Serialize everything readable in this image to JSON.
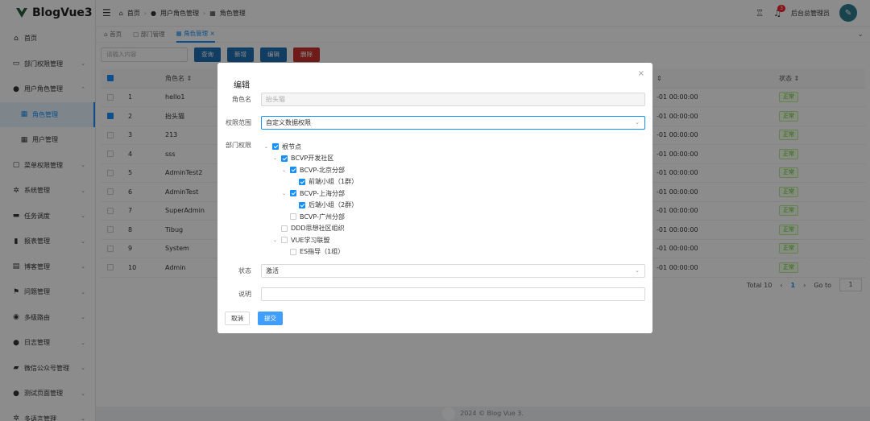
{
  "app": {
    "logo": "BlogVue3"
  },
  "sidebar": {
    "items": [
      {
        "label": "首页",
        "icon": "home-icon",
        "glyph": "⌂",
        "arrow": ""
      },
      {
        "label": "部门权限管理",
        "icon": "briefcase-icon",
        "glyph": "▭",
        "arrow": "⌄"
      },
      {
        "label": "用户角色管理",
        "icon": "user-icon",
        "glyph": "●",
        "arrow": "⌃"
      },
      {
        "label": "角色管理",
        "icon": "grid-icon",
        "glyph": "▦",
        "arrow": "",
        "sub": true,
        "active": true
      },
      {
        "label": "用户管理",
        "icon": "grid-icon",
        "glyph": "▦",
        "arrow": "",
        "sub": true
      },
      {
        "label": "菜单权限管理",
        "icon": "lock-icon",
        "glyph": "▢",
        "arrow": "⌄"
      },
      {
        "label": "系统管理",
        "icon": "gear-icon",
        "glyph": "✲",
        "arrow": "⌄"
      },
      {
        "label": "任务调度",
        "icon": "task-icon",
        "glyph": "▬",
        "arrow": "⌄"
      },
      {
        "label": "报表管理",
        "icon": "bar-chart-icon",
        "glyph": "▮",
        "arrow": "⌄"
      },
      {
        "label": "博客管理",
        "icon": "blog-icon",
        "glyph": "▤",
        "arrow": "⌄"
      },
      {
        "label": "问题管理",
        "icon": "flag-icon",
        "glyph": "⚑",
        "arrow": "⌄"
      },
      {
        "label": "多级路由",
        "icon": "route-icon",
        "glyph": "◉",
        "arrow": "⌄"
      },
      {
        "label": "日志管理",
        "icon": "log-icon",
        "glyph": "●",
        "arrow": "⌄"
      },
      {
        "label": "微信公众号管理",
        "icon": "wechat-icon",
        "glyph": "▰",
        "arrow": "⌄"
      },
      {
        "label": "测试页面管理",
        "icon": "test-icon",
        "glyph": "●",
        "arrow": "⌄"
      },
      {
        "label": "多语言管理",
        "icon": "language-icon",
        "glyph": "✲",
        "arrow": "⌄"
      }
    ]
  },
  "header": {
    "breadcrumb": [
      "首页",
      "用户角色管理",
      "角色管理"
    ],
    "user": "后台总管理员",
    "notification_count": "3"
  },
  "tabs": [
    {
      "label": "首页",
      "active": false
    },
    {
      "label": "部门管理",
      "active": false
    },
    {
      "label": "角色管理",
      "active": true
    }
  ],
  "toolbar": {
    "search_placeholder": "请输入内容",
    "query": "查询",
    "add": "新增",
    "edit": "编辑",
    "delete": "删除"
  },
  "table": {
    "headers": [
      "",
      "角色名 ⇕",
      "⇕",
      "状态 ⇕"
    ],
    "rows": [
      {
        "idx": "1",
        "name": "hello1",
        "date": "-01 00:00:00",
        "status": "正常",
        "checked": false
      },
      {
        "idx": "2",
        "name": "抬头猫",
        "date": "-01 00:00:00",
        "status": "正常",
        "checked": true
      },
      {
        "idx": "3",
        "name": "213",
        "date": "-01 00:00:00",
        "status": "正常",
        "checked": false
      },
      {
        "idx": "4",
        "name": "sss",
        "date": "-01 00:00:00",
        "status": "正常",
        "checked": false
      },
      {
        "idx": "5",
        "name": "AdminTest2",
        "date": "-01 00:00:00",
        "status": "正常",
        "checked": false
      },
      {
        "idx": "6",
        "name": "AdminTest",
        "date": "-01 00:00:00",
        "status": "正常",
        "checked": false
      },
      {
        "idx": "7",
        "name": "SuperAdmin",
        "date": "-01 00:00:00",
        "status": "正常",
        "checked": false
      },
      {
        "idx": "8",
        "name": "Tibug",
        "date": "-01 00:00:00",
        "status": "正常",
        "checked": false
      },
      {
        "idx": "9",
        "name": "System",
        "date": "-01 00:00:00",
        "status": "正常",
        "checked": false
      },
      {
        "idx": "10",
        "name": "Admin",
        "date": "-01 00:00:00",
        "status": "正常",
        "checked": false
      }
    ]
  },
  "pager": {
    "total": "Total 10",
    "page": "1",
    "goto": "Go to",
    "goto_value": "1"
  },
  "footer": {
    "text": "2024 © Blog Vue 3."
  },
  "modal": {
    "title": "编辑",
    "role_label": "角色名",
    "role_value": "抬头猫",
    "scope_label": "权限范围",
    "scope_value": "自定义数据权限",
    "dept_label": "部门权限",
    "status_label": "状态",
    "status_value": "激活",
    "desc_label": "说明",
    "desc_value": "",
    "cancel": "取消",
    "submit": "提交",
    "tree": [
      {
        "label": "根节点",
        "level": 0,
        "arrow": "⌄",
        "checked": true
      },
      {
        "label": "BCVP开发社区",
        "level": 1,
        "arrow": "⌄",
        "checked": true
      },
      {
        "label": "BCVP-北京分部",
        "level": 2,
        "arrow": "⌄",
        "checked": true
      },
      {
        "label": "前端小组（1群）",
        "level": 3,
        "arrow": "",
        "checked": true
      },
      {
        "label": "BCVP-上海分部",
        "level": 2,
        "arrow": "⌄",
        "checked": true
      },
      {
        "label": "后端小组（2群）",
        "level": 3,
        "arrow": "",
        "checked": true
      },
      {
        "label": "BCVP-广州分部",
        "level": 2,
        "arrow": "",
        "checked": false
      },
      {
        "label": "DDD思想社区组织",
        "level": 1,
        "arrow": "",
        "checked": false
      },
      {
        "label": "VUE学习联盟",
        "level": 1,
        "arrow": "⌄",
        "checked": false
      },
      {
        "label": "ES指导（1组）",
        "level": 2,
        "arrow": "",
        "checked": false
      }
    ]
  }
}
